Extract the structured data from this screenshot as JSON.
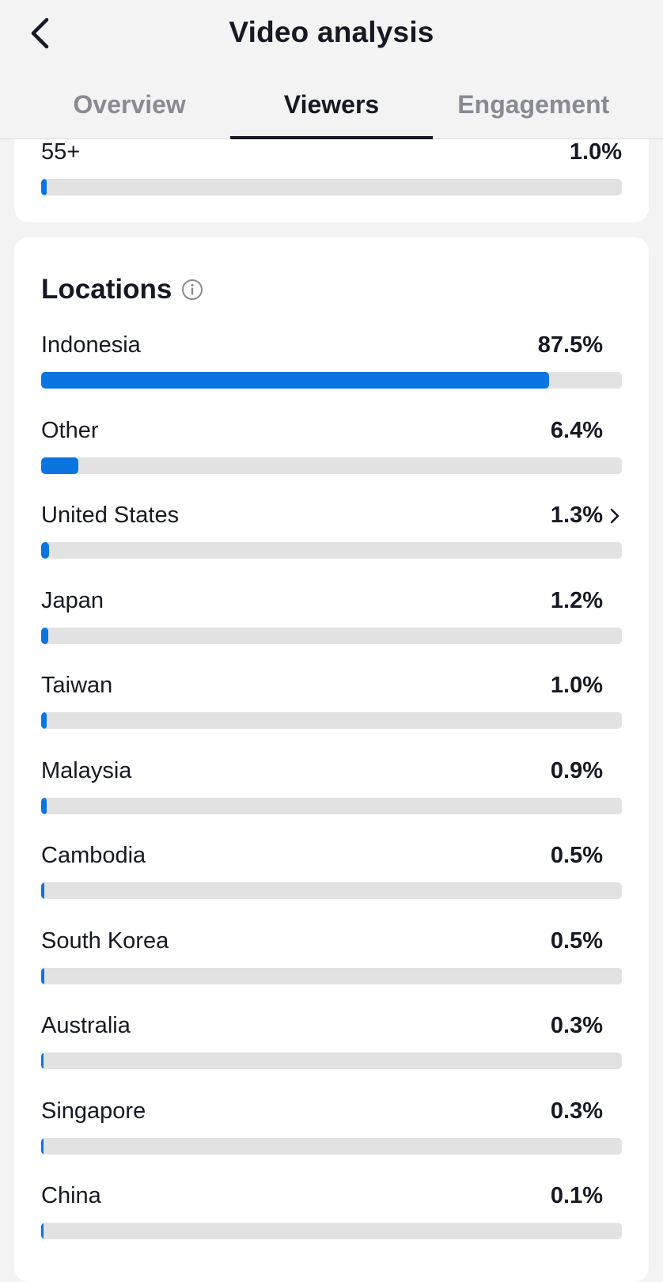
{
  "header": {
    "title": "Video analysis",
    "back_icon": "chevron-left-icon"
  },
  "tabs": [
    {
      "label": "Overview",
      "active": false
    },
    {
      "label": "Viewers",
      "active": true
    },
    {
      "label": "Engagement",
      "active": false
    }
  ],
  "age_row": {
    "label": "55+",
    "value": "1.0%",
    "fraction": 0.01
  },
  "locations": {
    "title": "Locations",
    "info_icon": "info-icon",
    "items": [
      {
        "label": "Indonesia",
        "value": "87.5%",
        "fraction": 0.875,
        "has_chevron": false
      },
      {
        "label": "Other",
        "value": "6.4%",
        "fraction": 0.064,
        "has_chevron": false
      },
      {
        "label": "United States",
        "value": "1.3%",
        "fraction": 0.013,
        "has_chevron": true
      },
      {
        "label": "Japan",
        "value": "1.2%",
        "fraction": 0.012,
        "has_chevron": false
      },
      {
        "label": "Taiwan",
        "value": "1.0%",
        "fraction": 0.01,
        "has_chevron": false
      },
      {
        "label": "Malaysia",
        "value": "0.9%",
        "fraction": 0.009,
        "has_chevron": false
      },
      {
        "label": "Cambodia",
        "value": "0.5%",
        "fraction": 0.005,
        "has_chevron": false
      },
      {
        "label": "South Korea",
        "value": "0.5%",
        "fraction": 0.005,
        "has_chevron": false
      },
      {
        "label": "Australia",
        "value": "0.3%",
        "fraction": 0.003,
        "has_chevron": false
      },
      {
        "label": "Singapore",
        "value": "0.3%",
        "fraction": 0.003,
        "has_chevron": false
      },
      {
        "label": "China",
        "value": "0.1%",
        "fraction": 0.001,
        "has_chevron": false
      }
    ]
  },
  "colors": {
    "bar_fill": "#0a75e0",
    "bar_track": "#e2e2e2",
    "background": "#f3f3f3",
    "card": "#ffffff"
  }
}
